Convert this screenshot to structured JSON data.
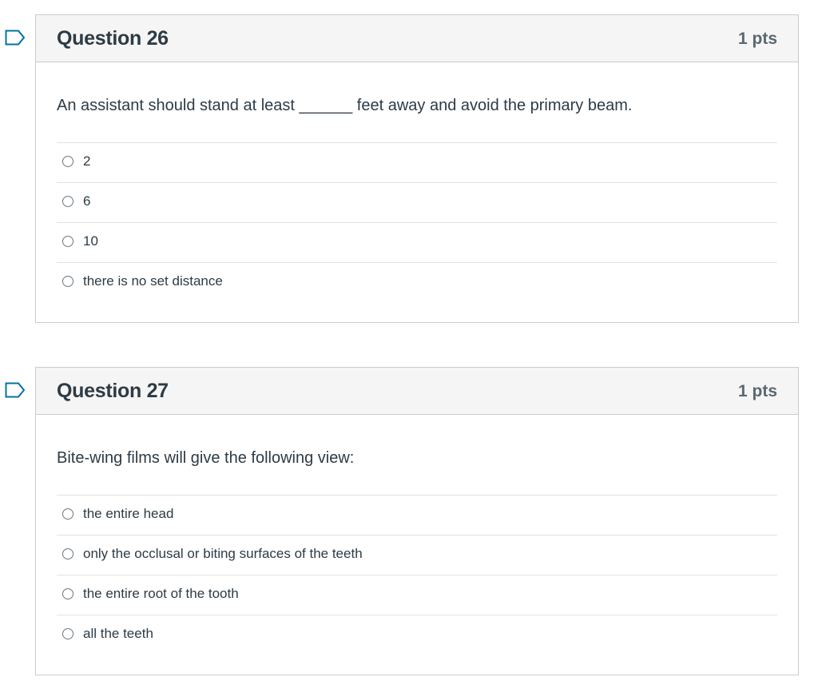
{
  "questions": [
    {
      "title": "Question 26",
      "points": "1 pts",
      "text": "An assistant should stand at least ______ feet away and avoid the primary beam.",
      "answers": [
        "2",
        "6",
        "10",
        "there is no set distance"
      ]
    },
    {
      "title": "Question 27",
      "points": "1 pts",
      "text": "Bite-wing films will give the following view:",
      "answers": [
        "the entire head",
        "only the occlusal or biting surfaces of the teeth",
        "the entire root of the tooth",
        "all the teeth"
      ]
    }
  ],
  "colors": {
    "flag": "#0770a3",
    "header_bg": "#f5f5f5",
    "border": "#c7cdd1",
    "text": "#2d3b45"
  },
  "icons": {
    "flag": "flag-question-icon",
    "radio": "radio-button-icon"
  }
}
